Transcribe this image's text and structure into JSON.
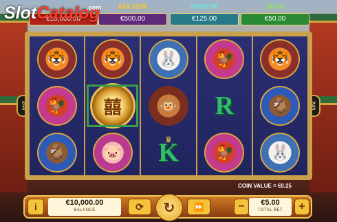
{
  "logo": {
    "part1": "Slot",
    "part2": "Catalog",
    "suffix": ".com"
  },
  "jackpots": {
    "grand": {
      "value": "€10,000.00"
    },
    "major": {
      "label": "MAJOR",
      "value": "€500.00"
    },
    "minor": {
      "label": "MINOR",
      "value": "€125.00"
    },
    "mini": {
      "label": "MINI",
      "value": "€50.00"
    }
  },
  "ways_badge": "243",
  "reels": [
    [
      "tiger",
      "rooster",
      "goat"
    ],
    [
      "tiger",
      "coin-wild",
      "pig"
    ],
    [
      "rabbit",
      "monkey",
      "K"
    ],
    [
      "rooster",
      "R",
      "rooster"
    ],
    [
      "tiger",
      "goat",
      "rabbit"
    ]
  ],
  "symbol_glyphs": {
    "tiger": "🐯",
    "rooster": "🐓",
    "goat": "🐐",
    "pig": "🐷",
    "rabbit": "🐰",
    "monkey": "🐵",
    "coin-wild": "囍",
    "K": "K",
    "R": "R"
  },
  "coin_value": "COIN VALUE = €0.25",
  "controls": {
    "info": "i",
    "balance_value": "€10,000.00",
    "balance_label": "BALANCE",
    "auto_icon": "⟳",
    "spin_icon": "↻",
    "turbo_icon": "⏩",
    "minus": "−",
    "plus": "+",
    "bet_value": "€5.00",
    "bet_label": "TOTAL BET"
  }
}
